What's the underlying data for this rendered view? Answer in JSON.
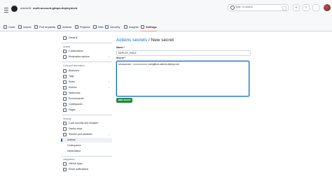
{
  "header": {
    "owner": "udemi15",
    "repo": "multi-account-gitops-deployment",
    "search_placeholder": "Type / to search",
    "plus_symbol": "+",
    "issue_symbol": "○"
  },
  "repo_nav": {
    "tabs": [
      {
        "label": "Code",
        "icon": "code-icon"
      },
      {
        "label": "Issues",
        "icon": "issue-icon"
      },
      {
        "label": "Pull requests",
        "icon": "pull-request-icon"
      },
      {
        "label": "Actions",
        "icon": "actions-icon"
      },
      {
        "label": "Projects",
        "icon": "projects-icon"
      },
      {
        "label": "Wiki",
        "icon": "wiki-icon"
      },
      {
        "label": "Security",
        "icon": "shield-icon"
      },
      {
        "label": "Insights",
        "icon": "graph-icon"
      },
      {
        "label": "Settings",
        "icon": "gear-icon",
        "selected": true
      }
    ]
  },
  "sidebar": {
    "general": "General",
    "access_heading": "Access",
    "collaborators": "Collaborators",
    "moderation": "Moderation options",
    "code_heading": "Code and automation",
    "branches": "Branches",
    "tags": "Tags",
    "rules": "Rules",
    "actions": "Actions",
    "webhooks": "Webhooks",
    "environments": "Environments",
    "codespaces": "Codespaces",
    "pages": "Pages",
    "security_heading": "Security",
    "code_security": "Code security and analysis",
    "deploy_keys": "Deploy keys",
    "secrets_vars": "Secrets and variables",
    "sub_actions": "Actions",
    "sub_codespaces": "Codespaces",
    "sub_dependabot": "Dependabot",
    "integrations_heading": "Integrations",
    "github_apps": "GitHub Apps",
    "email_notifications": "Email notifications",
    "chevron": "⌄"
  },
  "main": {
    "breadcrumb": "Actions secrets",
    "separator": " / ",
    "page_title": "New secret",
    "name_label": "Name *",
    "name_value": "DEPLOY_ROLE",
    "secret_label": "Secret *",
    "secret_prefix": "arn:aws:iam::",
    "secret_suffix": ":role/github-actions-deploy-role",
    "add_button": "Add secret"
  },
  "colors": {
    "accent": "#0969da",
    "success_button": "#1f883d",
    "selected_tab_underline": "#fd8c73"
  }
}
